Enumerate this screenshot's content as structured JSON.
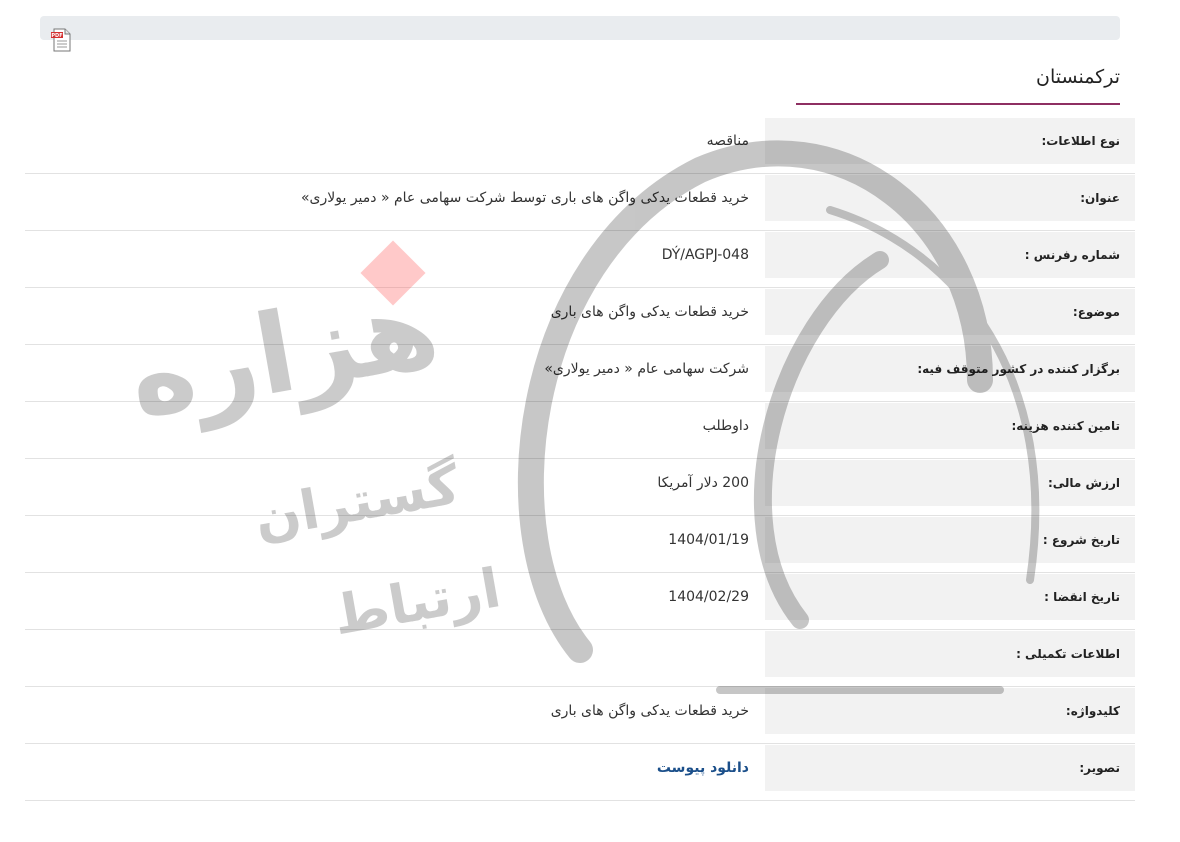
{
  "page": {
    "title": "ترکمنستان"
  },
  "toolbar": {
    "pdf_icon": "pdf-file-icon"
  },
  "rows": [
    {
      "label": "نوع اطلاعات:",
      "value": "مناقصه"
    },
    {
      "label": "عنوان:",
      "value": "خرید قطعات یدکی واگن های باری توسط شرکت سهامی عام « دمیر یولاری»"
    },
    {
      "label": "شماره رفرنس :",
      "value": "DÝ/AGPJ-048"
    },
    {
      "label": "موضوع:",
      "value": "خرید قطعات یدکی واگن های باری"
    },
    {
      "label": "برگزار کننده در کشور متوقف فیه:",
      "value": "شرکت سهامی عام « دمیر یولاری»"
    },
    {
      "label": "تامین کننده هزینه:",
      "value": "داوطلب"
    },
    {
      "label": "ارزش مالی:",
      "value": "200 دلار آمریکا"
    },
    {
      "label": "تاریخ شروع :",
      "value": "1404/01/19"
    },
    {
      "label": "تاریخ انقضا :",
      "value": "1404/02/29"
    },
    {
      "label": "اطلاعات تکمیلی :",
      "value": ""
    },
    {
      "label": "کلیدواژه:",
      "value": "خرید قطعات یدکی واگن های باری"
    },
    {
      "label": "تصویر:",
      "value": "دانلود پیوست"
    }
  ],
  "watermark": {
    "line1": "هزاره",
    "line2": "گستران",
    "line3": "ارتباط"
  },
  "colors": {
    "accent": "#8e2f62",
    "link": "#1b4f8a",
    "label_bg": "#f2f2f2"
  }
}
